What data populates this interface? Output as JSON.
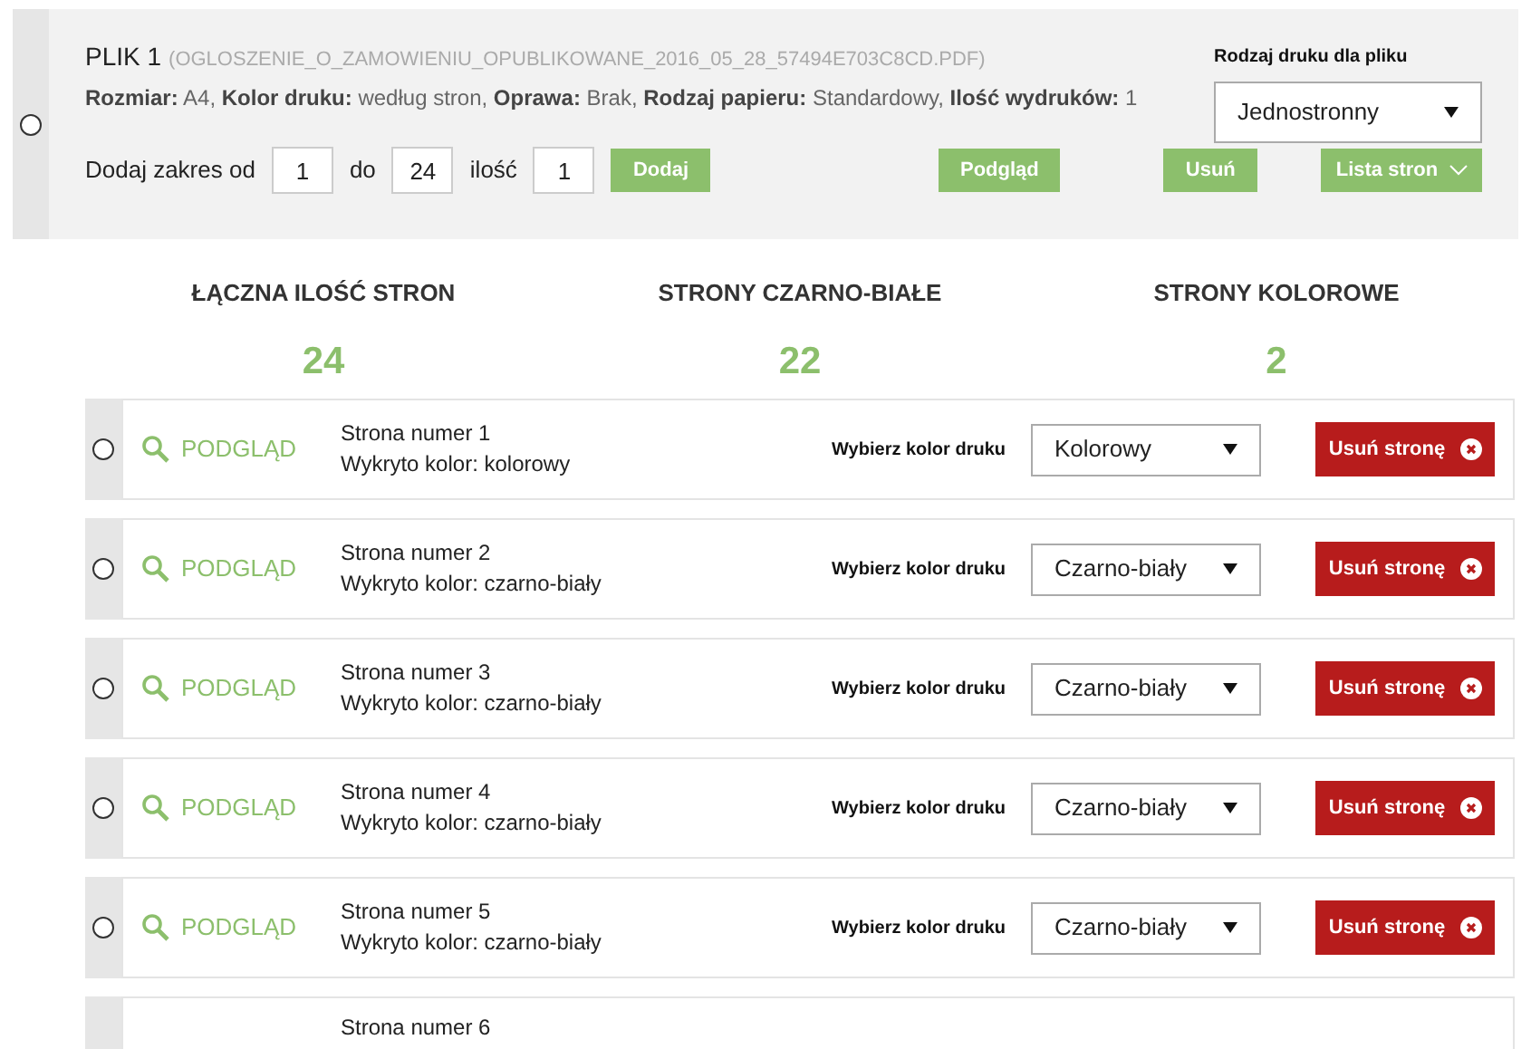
{
  "file": {
    "selected": false,
    "title": "PLIK 1",
    "filename": "(OGLOSZENIE_O_ZAMOWIENIU_OPUBLIKOWANE_2016_05_28_57494E703C8CD.PDF)",
    "details": "**Rozmiar:** A4, **Kolor druku:** według stron, **Oprawa:** Brak, **Rodzaj papieru:** Standardowy, **Ilość wydruków:** 1",
    "print_type_label": "Rodzaj druku dla pliku",
    "print_type": "Jednostronny",
    "range_label": "Dodaj zakres od",
    "range_from": "1",
    "range_to_label": "do",
    "range_to": "24",
    "quantity_label": "ilość",
    "quantity": "1",
    "add_button": "Dodaj",
    "preview_button": "Podgląd",
    "delete_button": "Usuń",
    "pages_list_button": "Lista stron"
  },
  "summary": [
    {
      "label": "ŁĄCZNA ILOŚĆ STRON",
      "value": "24"
    },
    {
      "label": "STRONY CZARNO-BIAŁE",
      "value": "22"
    },
    {
      "label": "STRONY KOLOROWE",
      "value": "2"
    }
  ],
  "pages": [
    {
      "kind": "full",
      "selected": false,
      "preview": "PODGLĄD",
      "title": "Strona numer 1",
      "detected": "Wykryto kolor: kolorowy",
      "color_label": "Wybierz kolor druku",
      "print_color": "Kolorowy",
      "delete": "Usuń stronę"
    },
    {
      "kind": "full",
      "selected": false,
      "preview": "PODGLĄD",
      "title": "Strona numer 2",
      "detected": "Wykryto kolor: czarno-biały",
      "color_label": "Wybierz kolor druku",
      "print_color": "Czarno-biały",
      "delete": "Usuń stronę"
    },
    {
      "kind": "full",
      "selected": false,
      "preview": "PODGLĄD",
      "title": "Strona numer 3",
      "detected": "Wykryto kolor: czarno-biały",
      "color_label": "Wybierz kolor druku",
      "print_color": "Czarno-biały",
      "delete": "Usuń stronę"
    },
    {
      "kind": "full",
      "selected": false,
      "preview": "PODGLĄD",
      "title": "Strona numer 4",
      "detected": "Wykryto kolor: czarno-biały",
      "color_label": "Wybierz kolor druku",
      "print_color": "Czarno-biały",
      "delete": "Usuń stronę"
    },
    {
      "kind": "full",
      "selected": false,
      "preview": "PODGLĄD",
      "title": "Strona numer 5",
      "detected": "Wykryto kolor: czarno-biały",
      "color_label": "Wybierz kolor druku",
      "print_color": "Czarno-biały",
      "delete": "Usuń stronę"
    },
    {
      "kind": "partial",
      "title": "Strona numer 6"
    }
  ]
}
